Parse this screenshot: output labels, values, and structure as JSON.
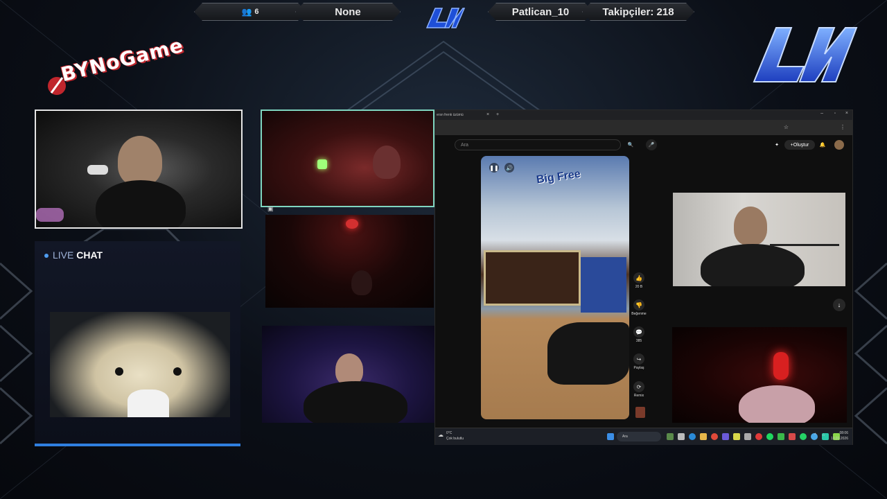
{
  "topbar": {
    "viewer_count": "6",
    "game": "None",
    "streamer": "Patlican_10",
    "followers": "Takipçiler: 218"
  },
  "overlay": {
    "brand_logo_text": "BYNoGame"
  },
  "chat": {
    "live_label": "LIVE",
    "chat_label": "CHAT"
  },
  "browser": {
    "tab_title": "ersn frenk üzümü",
    "search_placeholder": "Ara",
    "create_label": "Oluştur",
    "short_overlay_text": "Big Free",
    "actions": [
      {
        "icon": "thumbs-up-icon",
        "label": "20 B"
      },
      {
        "icon": "thumbs-down-icon",
        "label": "Beğenme"
      },
      {
        "icon": "comment-icon",
        "label": "385"
      },
      {
        "icon": "share-icon",
        "label": "Paylaş"
      },
      {
        "icon": "remix-icon",
        "label": "Remix"
      }
    ]
  },
  "taskbar": {
    "weather_temp": "0°C",
    "weather_desc": "Çok bulutlu",
    "search_label": "Ara",
    "time": "08:06",
    "date": "13.01.2026"
  },
  "colors": {
    "accent_blue": "#2f7fe0",
    "brand_red": "#c0262d",
    "frame_border": "#e6e6e6",
    "cam_highlight": "#7fd6c0"
  }
}
